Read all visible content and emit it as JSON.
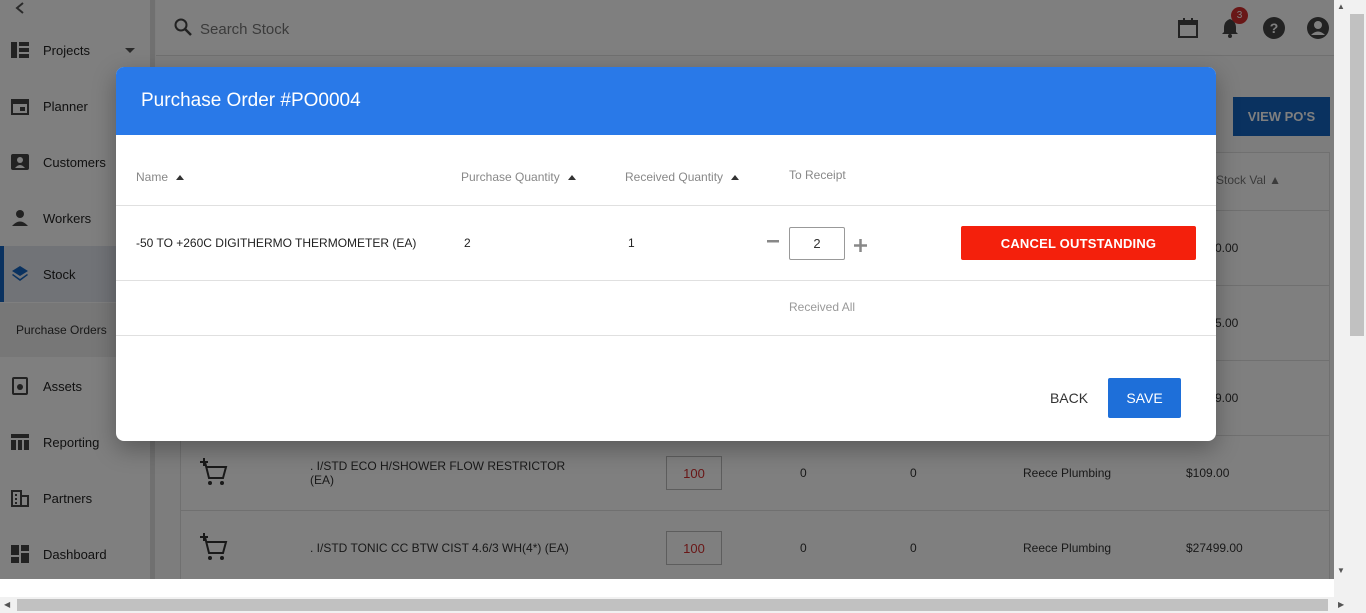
{
  "topbar": {
    "search_placeholder": "Search Stock",
    "notification_count": "3"
  },
  "sidebar": {
    "items": [
      {
        "label": "Projects",
        "icon": "projects-icon"
      },
      {
        "label": "Planner",
        "icon": "calendar-icon"
      },
      {
        "label": "Customers",
        "icon": "contact-card-icon"
      },
      {
        "label": "Workers",
        "icon": "person-icon"
      },
      {
        "label": "Stock",
        "icon": "layers-icon"
      },
      {
        "label": "Assets",
        "icon": "assets-icon"
      },
      {
        "label": "Reporting",
        "icon": "reporting-icon"
      },
      {
        "label": "Partners",
        "icon": "building-icon"
      },
      {
        "label": "Dashboard",
        "icon": "dashboard-icon"
      }
    ],
    "sub_item": "Purchase Orders"
  },
  "page": {
    "view_pos_label": "VIEW PO'S",
    "stock_val_header": "Stock Val",
    "rows": [
      {
        "value": "0.00"
      },
      {
        "value": "5.00"
      },
      {
        "value": "9.00"
      },
      {
        "name": ". I/STD ECO H/SHOWER FLOW RESTRICTOR (EA)",
        "qty": "100",
        "c1": "0",
        "c2": "0",
        "supplier": "Reece Plumbing",
        "value": "$109.00"
      },
      {
        "name": ". I/STD TONIC CC BTW CIST 4.6/3 WH(4*) (EA)",
        "qty": "100",
        "c1": "0",
        "c2": "0",
        "supplier": "Reece Plumbing",
        "value": "$27499.00"
      }
    ]
  },
  "dialog": {
    "title": "Purchase Order #PO0004",
    "headers": {
      "name": "Name",
      "purchase_qty": "Purchase Quantity",
      "received_qty": "Received Quantity",
      "to_receipt": "To Receipt"
    },
    "line": {
      "name": "-50 TO +260C DIGITHERMO THERMOMETER (EA)",
      "purchase_qty": "2",
      "received_qty": "1",
      "to_receipt": "2",
      "cancel_label": "CANCEL OUTSTANDING"
    },
    "received_all_label": "Received All",
    "back_label": "BACK",
    "save_label": "SAVE"
  }
}
